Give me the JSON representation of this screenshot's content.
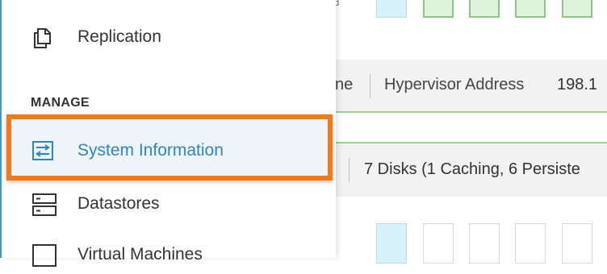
{
  "background": {
    "host_row": {
      "name_fragment": "ne",
      "field_label": "Hypervisor Address",
      "field_value_fragment": "198.1"
    },
    "disks_row": {
      "disks_text": "7 Disks (1 Caching, 6 Persiste"
    },
    "cubes_top": [
      "blue",
      "green",
      "green",
      "green",
      "green"
    ],
    "cubes_bottom": [
      "blue",
      "empty",
      "empty",
      "empty",
      "empty"
    ],
    "cut_text": "d"
  },
  "sidebar": {
    "items_top": [
      {
        "label": "Replication",
        "icon": "copy-icon"
      }
    ],
    "section_label": "MANAGE",
    "items_manage": [
      {
        "label": "System Information",
        "icon": "system-information-icon",
        "active": true
      },
      {
        "label": "Datastores",
        "icon": "datastores-icon"
      },
      {
        "label": "Virtual Machines",
        "icon": "virtual-machines-icon"
      }
    ]
  },
  "colors": {
    "accent": "#2c86c6",
    "highlight": "#f27a1a",
    "sidebar_border": "#3b9bd1"
  }
}
